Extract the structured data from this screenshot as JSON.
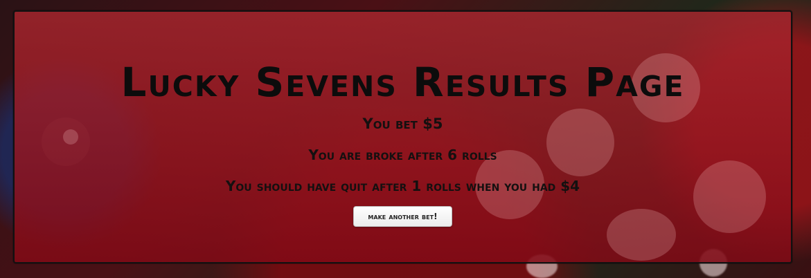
{
  "page": {
    "title": "Lucky Sevens Results Page"
  },
  "results": {
    "bet_line": "You bet $5",
    "broke_line": "You are broke after 6 rolls",
    "quit_line": "You should have quit after 1 rolls when you had $4"
  },
  "actions": {
    "another_bet_label": "make another bet!"
  },
  "colors": {
    "panel": "#a3242e",
    "text": "#0c0c0c",
    "button_bg": "#ffffff"
  }
}
